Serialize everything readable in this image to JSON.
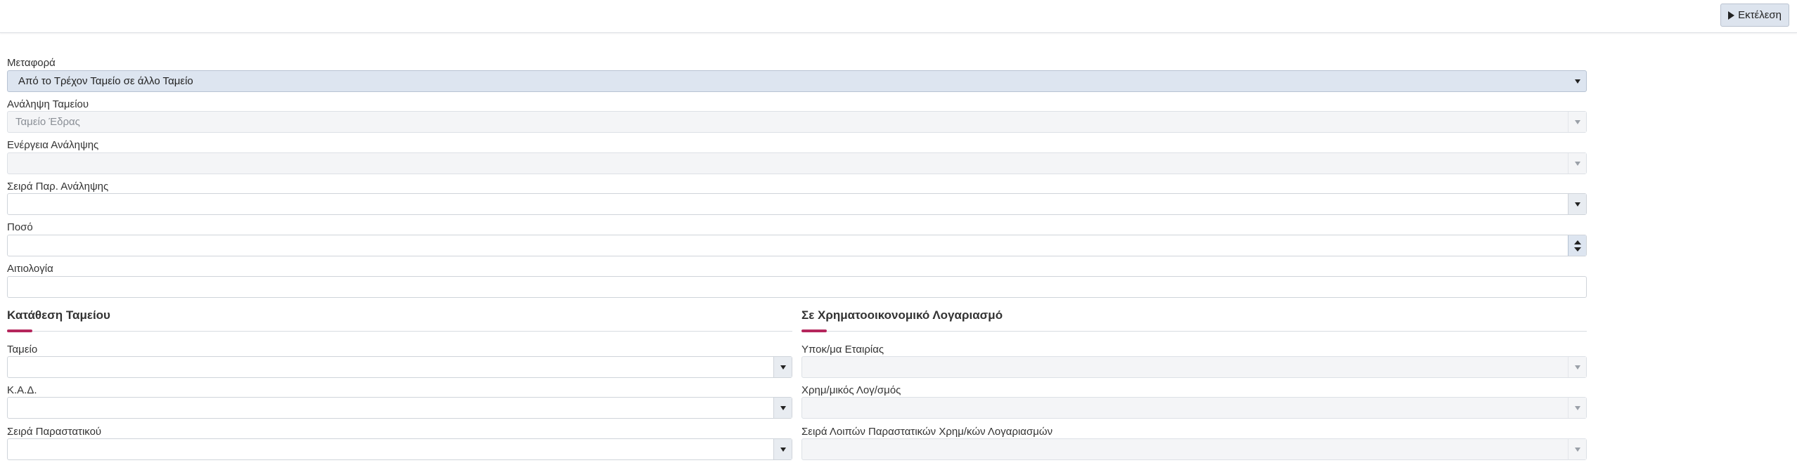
{
  "toolbar": {
    "run_label": "Εκτέλεση",
    "run_icon": "play-icon"
  },
  "form": {
    "transfer": {
      "label": "Μεταφορά",
      "value": "Από το Τρέχον Ταμείο σε άλλο Ταμείο"
    },
    "withdraw_cash": {
      "label": "Ανάληψη Ταμείου",
      "value": "Ταμείο Έδρας"
    },
    "withdraw_action": {
      "label": "Ενέργεια Ανάληψης",
      "value": ""
    },
    "withdraw_series": {
      "label": "Σειρά Παρ. Ανάληψης",
      "value": ""
    },
    "amount": {
      "label": "Ποσό",
      "value": ""
    },
    "reason": {
      "label": "Αιτιολογία",
      "value": ""
    }
  },
  "deposit_section": {
    "title": "Κατάθεση Ταμείου",
    "fields": [
      {
        "label": "Ταμείο",
        "value": ""
      },
      {
        "label": "Κ.Α.Δ.",
        "value": ""
      },
      {
        "label": "Σειρά Παραστατικού",
        "value": ""
      }
    ]
  },
  "financial_section": {
    "title": "Σε Χρηματοοικονομικό Λογαριασμό",
    "fields": [
      {
        "label": "Υποκ/μα Εταιρίας",
        "value": ""
      },
      {
        "label": "Χρημ/μικός Λογ/σμός",
        "value": ""
      },
      {
        "label": "Σειρά Λοιπών Παραστατικών Χρημ/κών Λογαριασμών",
        "value": ""
      }
    ]
  },
  "colors": {
    "accent": "#b5265c",
    "selected_bg": "#dde5f0",
    "disabled_bg": "#f4f5f7"
  }
}
